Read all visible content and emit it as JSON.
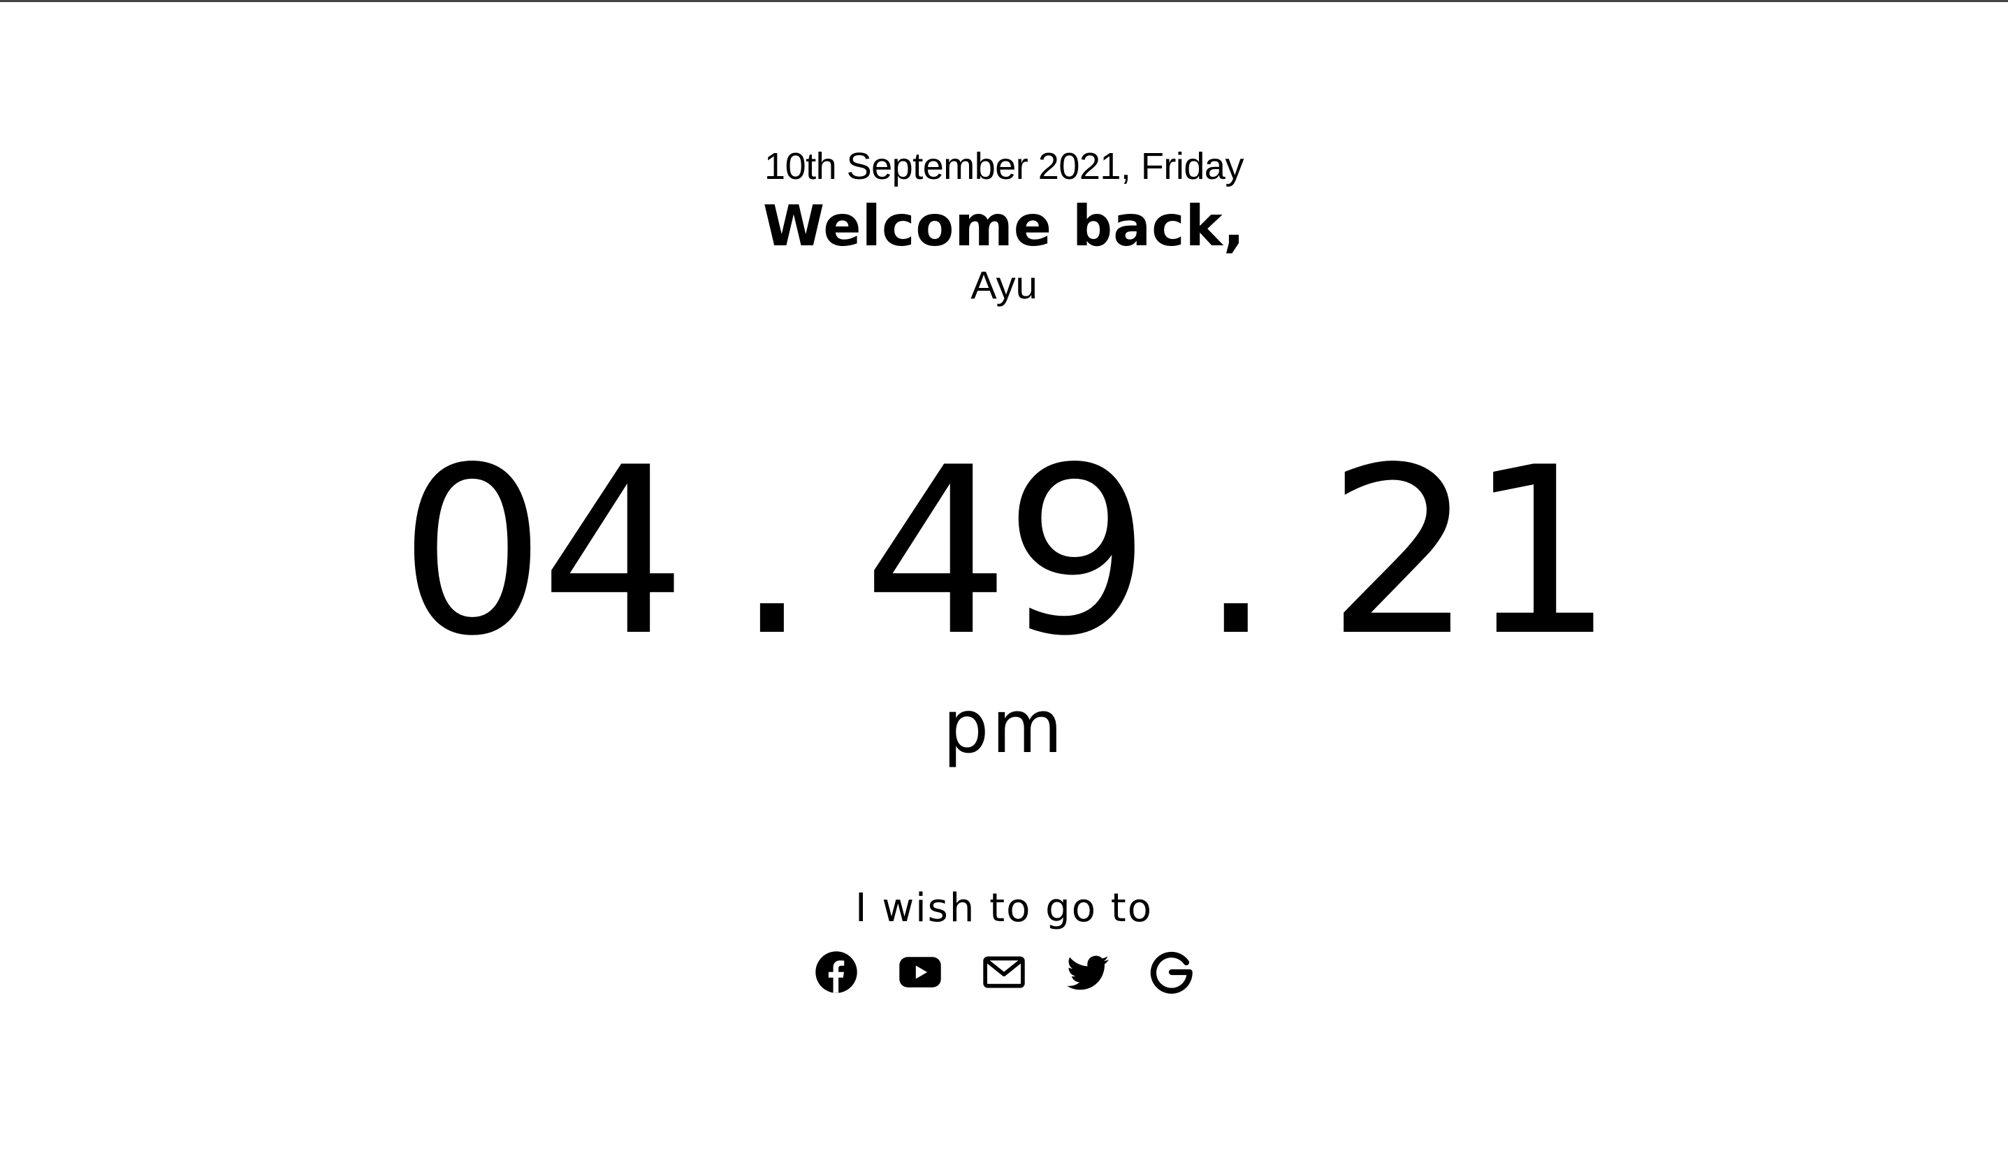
{
  "header": {
    "date": "10th September 2021, Friday",
    "greeting": "Welcome back,",
    "username": "Ayu"
  },
  "clock": {
    "hours": "04",
    "minutes": "49",
    "seconds": "21",
    "separator": ".",
    "meridiem": "pm"
  },
  "links": {
    "heading": "I wish to go to",
    "items": [
      {
        "name": "Facebook",
        "icon": "facebook-icon"
      },
      {
        "name": "YouTube",
        "icon": "youtube-icon"
      },
      {
        "name": "Email",
        "icon": "mail-icon"
      },
      {
        "name": "Twitter",
        "icon": "twitter-icon"
      },
      {
        "name": "Google",
        "icon": "google-icon"
      }
    ]
  },
  "colors": {
    "text": "#000000",
    "background": "#ffffff"
  }
}
